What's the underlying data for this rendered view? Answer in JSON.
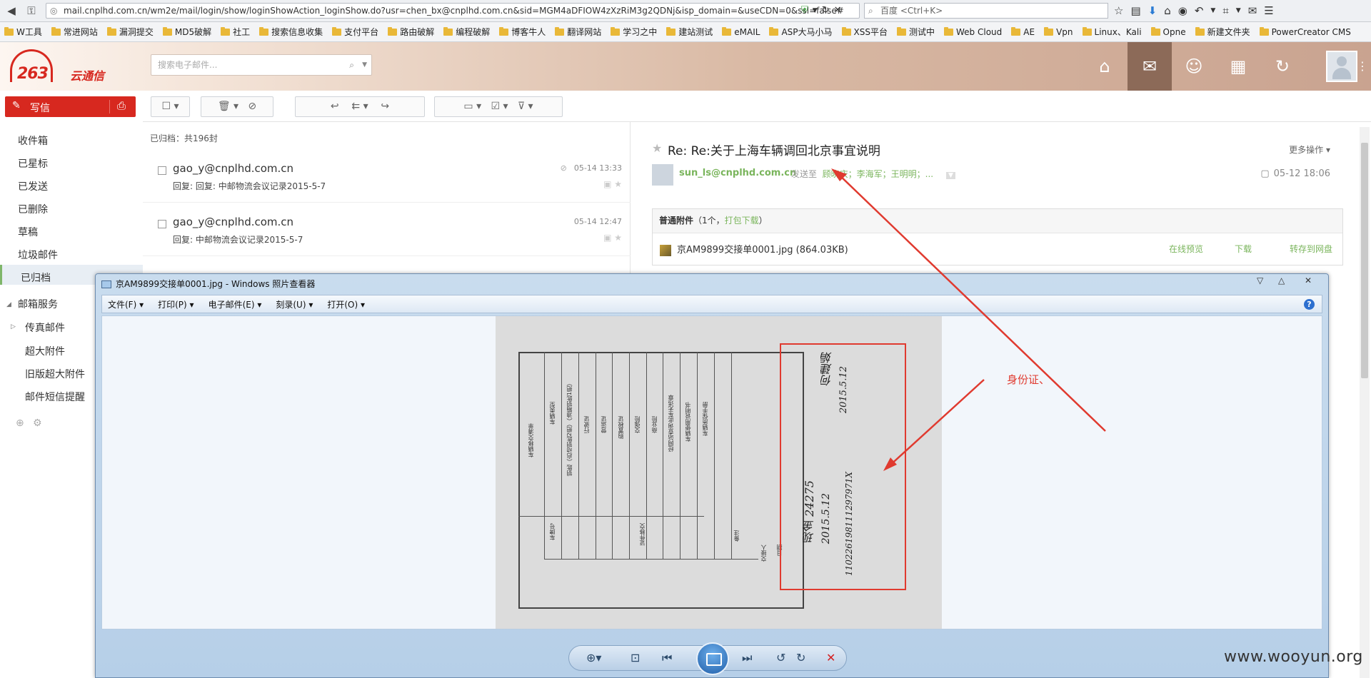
{
  "browser": {
    "url": "mail.cnplhd.com.cn/wm2e/mail/login/show/loginShowAction_loginShow.do?usr=chen_bx@cnplhd.com.cn&sid=MGM4aDFIOW4zXzRiM3g2QDNj&isp_domain=&useCDN=0&ssl=false#",
    "search_placeholder": "百度 <Ctrl+K>",
    "bookmarks": [
      "W工具",
      "常进网站",
      "漏洞提交",
      "MD5破解",
      "社工",
      "搜索信息收集",
      "支付平台",
      "路由破解",
      "编程破解",
      "博客牛人",
      "翻译网站",
      "学习之中",
      "建站测试",
      "eMAIL",
      "ASP大马小马",
      "XSS平台",
      "测试中",
      "Web Cloud",
      "AE",
      "Vpn",
      "Linux、Kali",
      "Opne",
      "新建文件夹",
      "PowerCreator CMS"
    ]
  },
  "app": {
    "logo_num": "263",
    "logo_text": "云通信",
    "search_placeholder": "搜索电子邮件..."
  },
  "sidebar": {
    "compose_label": "写信",
    "folders": [
      "收件箱",
      "已星标",
      "已发送",
      "已删除",
      "草稿",
      "垃圾邮件",
      "已归档"
    ],
    "services_header": "邮箱服务",
    "services": [
      "传真邮件",
      "超大附件",
      "旧版超大附件",
      "邮件短信提醒"
    ]
  },
  "list": {
    "count_label": "已归档：共196封",
    "rows": [
      {
        "from": "gao_y@cnplhd.com.cn",
        "subject": "回复: 回复: 中邮物流会议记录2015-5-7",
        "date": "05-14 13:33"
      },
      {
        "from": "gao_y@cnplhd.com.cn",
        "subject": "回复: 中邮物流会议记录2015-5-7",
        "date": "05-14 12:47"
      }
    ]
  },
  "reader": {
    "subject": "Re: Re:关于上海车辆调回北京事宜说明",
    "more_actions": "更多操作",
    "from": "sun_ls@cnplhd.com.cn",
    "sent_to_label": "发送至",
    "recipients": "顾晓庆；李海军；王明明；...",
    "date": "05-12 18:06",
    "attachments_title": "普通附件",
    "attachments_count": "（1个，",
    "download_all": "打包下载",
    "attachments_close": "）",
    "file_name": "京AM9899交接单0001.jpg (864.03KB)",
    "preview": "在线预览",
    "download": "下载",
    "save_cloud": "转存到网盘"
  },
  "viewer": {
    "title": "京AM9899交接单0001.jpg - Windows 照片查看器",
    "menu": [
      "文件(F)",
      "打印(P)",
      "电子邮件(E)",
      "刻录(U)",
      "打开(O)"
    ],
    "help": "?",
    "doc": {
      "col_labels": [
        "车辆移交清单",
        "车辆类型",
        "车牌号",
        "钥匙（启动钥匙2把）（油箱钥匙1把）",
        "行驶证",
        "营运证",
        "购置税证",
        "交强险",
        "商业险",
        "经网站查询此车无违章",
        "车辆使用说明书",
        "车辆质保手册",
        "证件移交",
        "备注",
        "交接人",
        "日期"
      ],
      "handwriting": [
        "何建娟",
        "2015.5.12",
        "现金 24275",
        "2015.5.12",
        "110226198111297971X"
      ]
    }
  },
  "annotation": {
    "label": "身份证、"
  },
  "watermark": "www.wooyun.org"
}
